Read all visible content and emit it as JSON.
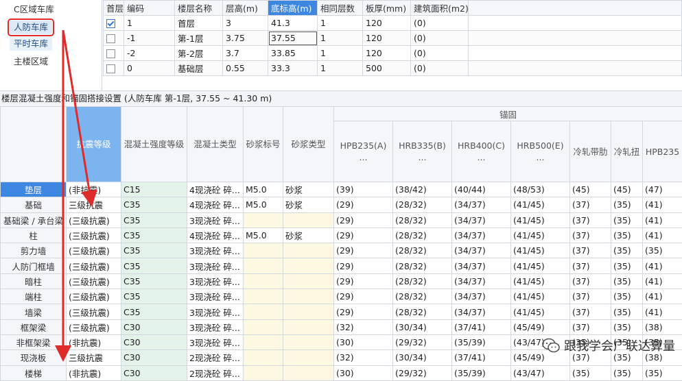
{
  "regions": [
    {
      "label": "C区域车库"
    },
    {
      "label": "人防车库"
    },
    {
      "label": "平时车库"
    },
    {
      "label": "主楼区域"
    }
  ],
  "floor_table": {
    "headers": [
      "首层",
      "编码",
      "楼层名称",
      "层高(m)",
      "底标高(m)",
      "相同层数",
      "板厚(mm)",
      "建筑面积(m2)"
    ],
    "rows": [
      {
        "first": true,
        "code": "1",
        "name": "首层",
        "height": "3",
        "bottom": "41.3",
        "same": "1",
        "thick": "120",
        "area": "(0)"
      },
      {
        "first": false,
        "code": "-1",
        "name": "第-1层",
        "height": "3.75",
        "bottom": "37.55",
        "same": "1",
        "thick": "120",
        "area": "(0)"
      },
      {
        "first": false,
        "code": "-2",
        "name": "第-2层",
        "height": "3.7",
        "bottom": "33.85",
        "same": "1",
        "thick": "120",
        "area": "(0)"
      },
      {
        "first": false,
        "code": "0",
        "name": "基础层",
        "height": "0.55",
        "bottom": "33.3",
        "same": "1",
        "thick": "500",
        "area": "(0)"
      }
    ]
  },
  "caption": "楼层混凝土强度和锚固搭接设置 (人防车库 第-1层, 37.55 ~ 41.30 m)",
  "grid": {
    "group_header": "锚固",
    "headers": [
      "抗震等级",
      "混凝土强度等级",
      "混凝土类型",
      "砂浆标号",
      "砂浆类型"
    ],
    "anchor_headers": [
      "HPB235(A)\n...",
      "HRB335(B)\n...",
      "HRB400(C)\n...",
      "HRB500(E)\n...",
      "冷轧带肋",
      "冷轧扭",
      "HPB235"
    ],
    "rows": [
      {
        "name": "垫层",
        "seismic": "(非抗震)",
        "conc": "C15",
        "ctype": "4现浇砼 碎...",
        "mortar": "M5.0",
        "mtype": "砂浆",
        "a": [
          "(39)",
          "(38/42)",
          "(40/44)",
          "(48/53)",
          "(45)",
          "(45)",
          "(47)"
        ]
      },
      {
        "name": "基础",
        "seismic": "三级抗震",
        "conc": "C35",
        "ctype": "4现浇砼 碎...",
        "mortar": "M5.0",
        "mtype": "砂浆",
        "a": [
          "(29)",
          "(28/32)",
          "(34/37)",
          "(41/45)",
          "(37)",
          "(35)",
          "(41)"
        ]
      },
      {
        "name": "基础梁 / 承台梁",
        "seismic": "(三级抗震)",
        "conc": "C35",
        "ctype": "3现浇砼 碎...",
        "mortar": "",
        "mtype": "",
        "a": [
          "(29)",
          "(28/32)",
          "(34/37)",
          "(41/45)",
          "(37)",
          "(35)",
          "(41)"
        ]
      },
      {
        "name": "柱",
        "seismic": "(三级抗震)",
        "conc": "C35",
        "ctype": "4现浇砼 碎...",
        "mortar": "M5.0",
        "mtype": "砂浆",
        "a": [
          "(29)",
          "(28/32)",
          "(34/37)",
          "(41/45)",
          "(37)",
          "(35)",
          "(41)"
        ]
      },
      {
        "name": "剪力墙",
        "seismic": "(三级抗震)",
        "conc": "C35",
        "ctype": "3现浇砼 碎...",
        "mortar": "",
        "mtype": "",
        "a": [
          "(29)",
          "(28/32)",
          "(34/37)",
          "(41/45)",
          "(37)",
          "(35)",
          "(35)"
        ]
      },
      {
        "name": "人防门框墙",
        "seismic": "(三级抗震)",
        "conc": "C35",
        "ctype": "3现浇砼 碎...",
        "mortar": "",
        "mtype": "",
        "a": [
          "(29)",
          "(28/32)",
          "(34/37)",
          "(41/45)",
          "(37)",
          "(35)",
          "(41)"
        ]
      },
      {
        "name": "暗柱",
        "seismic": "(三级抗震)",
        "conc": "C35",
        "ctype": "3现浇砼 碎...",
        "mortar": "",
        "mtype": "",
        "a": [
          "(29)",
          "(28/32)",
          "(34/37)",
          "(41/45)",
          "(37)",
          "(35)",
          "(41)"
        ]
      },
      {
        "name": "端柱",
        "seismic": "(三级抗震)",
        "conc": "C35",
        "ctype": "3现浇砼 碎...",
        "mortar": "",
        "mtype": "",
        "a": [
          "(29)",
          "(28/32)",
          "(34/37)",
          "(41/45)",
          "(37)",
          "(35)",
          "(41)"
        ]
      },
      {
        "name": "墙梁",
        "seismic": "(三级抗震)",
        "conc": "C35",
        "ctype": "3现浇砼 碎...",
        "mortar": "",
        "mtype": "",
        "a": [
          "(29)",
          "(28/32)",
          "(34/37)",
          "(41/45)",
          "(37)",
          "(35)",
          "(41)"
        ]
      },
      {
        "name": "框架梁",
        "seismic": "(三级抗震)",
        "conc": "C30",
        "ctype": "3现浇砼 碎...",
        "mortar": "",
        "mtype": "",
        "a": [
          "(32)",
          "(30/34)",
          "(37/41)",
          "(45/49)",
          "(37)",
          "(35)",
          "(38)"
        ]
      },
      {
        "name": "非框架梁",
        "seismic": "(非抗震)",
        "conc": "C30",
        "ctype": "3现浇砼 碎...",
        "mortar": "",
        "mtype": "",
        "a": [
          "(30)",
          "(29/32)",
          "(35/39)",
          "(43/47)",
          "(35)",
          "(35)",
          "(35)"
        ]
      },
      {
        "name": "现浇板",
        "seismic": "三级抗震",
        "conc": "C30",
        "ctype": "2现浇砼 碎...",
        "mortar": "",
        "mtype": "",
        "a": [
          "(32)",
          "(30/34)",
          "(37/41)",
          "(45/49)",
          "(37)",
          "(35)",
          "(38)"
        ]
      },
      {
        "name": "楼梯",
        "seismic": "(非抗震)",
        "conc": "C30",
        "ctype": "2现浇砼 碎...",
        "mortar": "",
        "mtype": "",
        "a": [
          "(30)",
          "(29/32)",
          "(35/39)",
          "(43/47)",
          "(35)",
          "(35)",
          "(35)"
        ]
      }
    ]
  },
  "watermark": {
    "text": "跟我学会广联达算量",
    "icon": "wechat-icon"
  },
  "colors": {
    "accent": "#3e87e0",
    "highlight_header": "#7cb4f0",
    "green_cell": "#e4f3ea",
    "yellow_cell": "#fdf8e1",
    "annotation": "#e02b2b"
  }
}
